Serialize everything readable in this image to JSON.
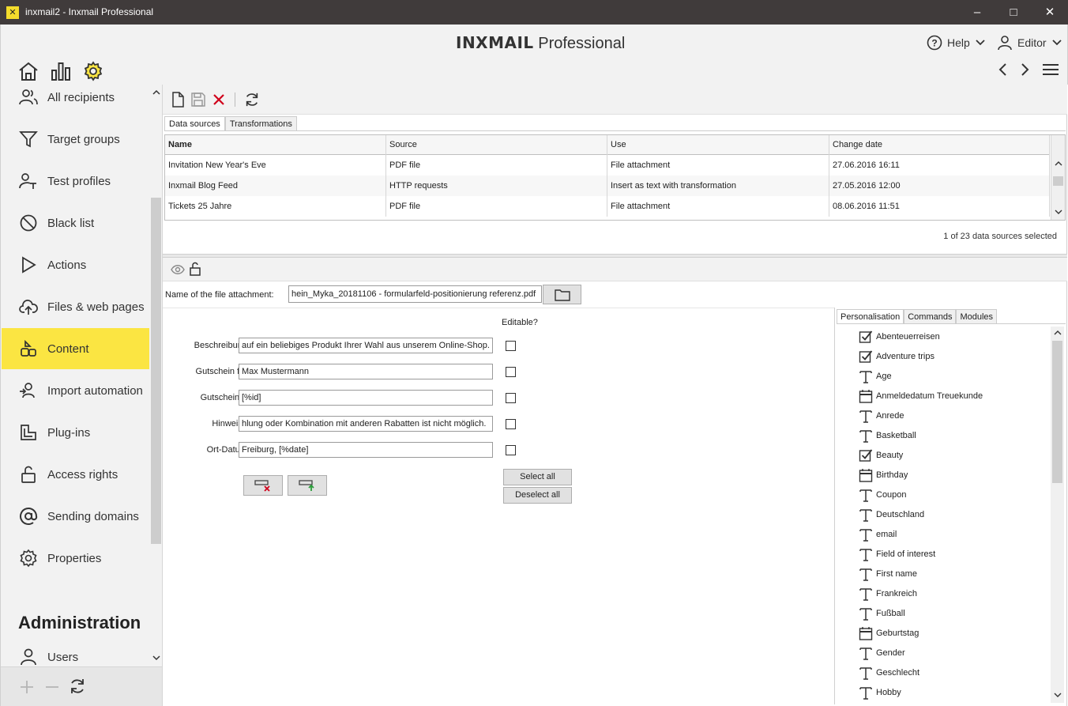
{
  "window": {
    "title": "inxmail2 - Inxmail Professional",
    "app_icon": "x-logo-icon",
    "controls": [
      "minimize",
      "maximize",
      "close"
    ]
  },
  "header": {
    "brand_bold": "INXMAIL",
    "brand_light": "Professional",
    "help_label": "Help",
    "user_label": "Editor"
  },
  "sidebar": {
    "items": [
      {
        "label": "All recipients",
        "icon": "recipients-icon"
      },
      {
        "label": "Target groups",
        "icon": "filter-icon"
      },
      {
        "label": "Test profiles",
        "icon": "test-profile-icon"
      },
      {
        "label": "Black list",
        "icon": "block-icon"
      },
      {
        "label": "Actions",
        "icon": "play-icon"
      },
      {
        "label": "Files & web pages",
        "icon": "upload-cloud-icon"
      },
      {
        "label": "Content",
        "icon": "content-icon",
        "active": true
      },
      {
        "label": "Import automation",
        "icon": "import-icon"
      },
      {
        "label": "Plug-ins",
        "icon": "plugin-icon"
      },
      {
        "label": "Access rights",
        "icon": "lock-icon"
      },
      {
        "label": "Sending domains",
        "icon": "at-icon"
      },
      {
        "label": "Properties",
        "icon": "gear-icon"
      }
    ],
    "admin_heading": "Administration",
    "admin_items": [
      {
        "label": "Users",
        "icon": "user-icon"
      }
    ]
  },
  "main": {
    "tabs": [
      "Data sources",
      "Transformations"
    ],
    "table": {
      "columns": [
        "Name",
        "Source",
        "Use",
        "Change date"
      ],
      "rows": [
        [
          "Invitation New Year's Eve",
          "PDF file",
          "File attachment",
          "27.06.2016 16:11"
        ],
        [
          "Inxmail Blog Feed",
          "HTTP requests",
          "Insert as text with transformation",
          "27.05.2016 12:00"
        ],
        [
          "Tickets 25 Jahre",
          "PDF file",
          "File attachment",
          "08.06.2016 11:51"
        ]
      ]
    },
    "status": "1 of 23 data sources selected",
    "file_attachment": {
      "label": "Name of the file attachment:",
      "value": "hein_Myka_20181106 - formularfeld-positionierung referenz.pdf"
    },
    "form": {
      "editable_heading": "Editable?",
      "fields": [
        {
          "label": "Beschreibung:",
          "value": "auf ein beliebiges Produkt Ihrer Wahl aus unserem Online-Shop."
        },
        {
          "label": "Gutschein für:",
          "value": "Max Mustermann"
        },
        {
          "label": "Gutscheinnr:",
          "value": "[%id]"
        },
        {
          "label": "Hinweise:",
          "value": "hlung oder Kombination mit anderen Rabatten ist nicht möglich."
        },
        {
          "label": "Ort-Datum:",
          "value": "Freiburg, [%date]"
        }
      ],
      "select_all": "Select all",
      "deselect_all": "Deselect all"
    }
  },
  "personalisation": {
    "tabs": [
      "Personalisation",
      "Commands",
      "Modules"
    ],
    "items": [
      {
        "label": "Abenteuerreisen",
        "type": "check"
      },
      {
        "label": "Adventure trips",
        "type": "check"
      },
      {
        "label": "Age",
        "type": "text"
      },
      {
        "label": "Anmeldedatum Treuekunde",
        "type": "date"
      },
      {
        "label": "Anrede",
        "type": "text"
      },
      {
        "label": "Basketball",
        "type": "text"
      },
      {
        "label": "Beauty",
        "type": "check"
      },
      {
        "label": "Birthday",
        "type": "date"
      },
      {
        "label": "Coupon",
        "type": "text"
      },
      {
        "label": "Deutschland",
        "type": "text"
      },
      {
        "label": "email",
        "type": "text"
      },
      {
        "label": "Field of interest",
        "type": "text"
      },
      {
        "label": "First name",
        "type": "text"
      },
      {
        "label": "Frankreich",
        "type": "text"
      },
      {
        "label": "Fußball",
        "type": "text"
      },
      {
        "label": "Geburtstag",
        "type": "date"
      },
      {
        "label": "Gender",
        "type": "text"
      },
      {
        "label": "Geschlecht",
        "type": "text"
      },
      {
        "label": "Hobby",
        "type": "text"
      }
    ]
  },
  "colors": {
    "accent": "#fbe542",
    "titlebar": "#403b3b",
    "delete": "#d0021b"
  }
}
